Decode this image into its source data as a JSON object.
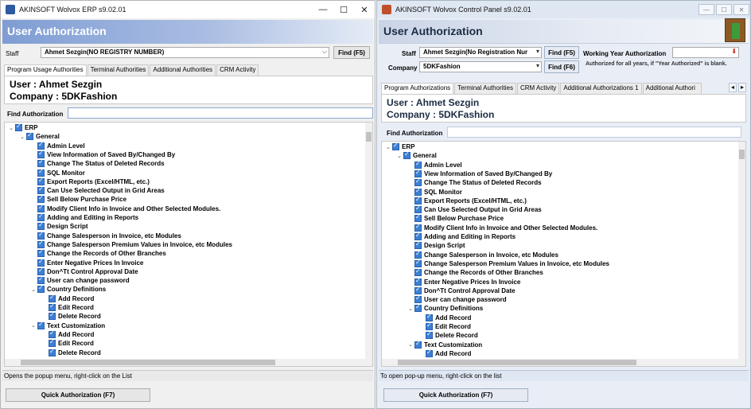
{
  "left": {
    "window_title": "AKINSOFT Wolvox ERP s9.02.01",
    "window_controls": {
      "minimize": "—",
      "maximize": "☐",
      "close": "✕"
    },
    "header_title": "User Authorization",
    "staff_label": "Staff",
    "staff_value": "Ahmet Sezgin(NO REGISTRY NUMBER)",
    "find_button": "Find (F5)",
    "tabs": [
      "Program Usage Authorities",
      "Terminal Authorities",
      "Additional Authorities",
      "CRM Activity"
    ],
    "user_line": "User : Ahmet Sezgin",
    "company_line": "Company : 5DKFashion",
    "find_auth_label": "Find Authorization",
    "find_auth_value": "",
    "tree": [
      "ERP",
      "General",
      "Admin Level",
      "View Information of Saved By/Changed By",
      "Change The Status of Deleted Records",
      "SQL Monitor",
      "Export Reports (Excel/HTML, etc.)",
      "Can Use Selected Output in Grid Areas",
      "Sell Below Purchase Price",
      "Modify Client Info in Invoice and Other Selected Modules.",
      "Adding and Editing in Reports",
      "Design Script",
      "Change Salesperson in Invoice, etc Modules",
      "Change Salesperson Premium Values in Invoice, etc Modules",
      "Change the Records of Other Branches",
      "Enter Negative Prices In Invoice",
      "Don^Tt Control Approval Date",
      "User can change password",
      "Country Definitions",
      "Add Record",
      "Edit Record",
      "Delete Record",
      "Text Customization",
      "Add Record",
      "Edit Record",
      "Delete Record"
    ],
    "status_text": "Opens the popup menu, right-click on the List",
    "quick_auth_button": "Quick Authorization (F7)"
  },
  "right": {
    "window_title": "AKINSOFT Wolvox Control Panel s9.02.01",
    "window_controls": {
      "minimize": "—",
      "maximize": "☐",
      "close": "✕"
    },
    "header_title": "User Authorization",
    "staff_label": "Staff",
    "staff_value": "Ahmet Sezgin(No Registration Nur",
    "company_label": "Company",
    "company_value": "5DKFashion",
    "find_f5": "Find (F5)",
    "find_f6": "Find (F6)",
    "working_year_label": "Working Year Authorization",
    "working_year_value": "",
    "working_year_note": "Authorized for all years, if \"Year Authorized\" is blank.",
    "tabs": [
      "Program Authorizations",
      "Terminal Authorities",
      "CRM Activity",
      "Additional Authorizations 1",
      "Additional Authori"
    ],
    "user_line": "User : Ahmet Sezgin",
    "company_line": "Company : 5DKFashion",
    "find_auth_label": "Find Authorization",
    "find_auth_value": "",
    "tree": [
      "ERP",
      "General",
      "Admin Level",
      "View Information of Saved By/Changed By",
      "Change The Status of Deleted Records",
      "SQL Monitor",
      "Export Reports (Excel/HTML, etc.)",
      "Can Use Selected Output in Grid Areas",
      "Sell Below Purchase Price",
      "Modify Client Info in Invoice and Other Selected Modules.",
      "Adding and Editing in Reports",
      "Design Script",
      "Change Salesperson in Invoice, etc Modules",
      "Change Salesperson Premium Values in Invoice, etc Modules",
      "Change the Records of Other Branches",
      "Enter Negative Prices In Invoice",
      "Don^Tt Control Approval Date",
      "User can change password",
      "Country Definitions",
      "Add Record",
      "Edit Record",
      "Delete Record",
      "Text Customization",
      "Add Record"
    ],
    "status_text": "To open pop-up menu, right-click on the list",
    "quick_auth_button": "Quick Authorization (F7)"
  },
  "colors": {
    "left_header": "#7f9dd3",
    "right_header": "#c9d4e6",
    "checkbox": "#3c7fd6"
  }
}
